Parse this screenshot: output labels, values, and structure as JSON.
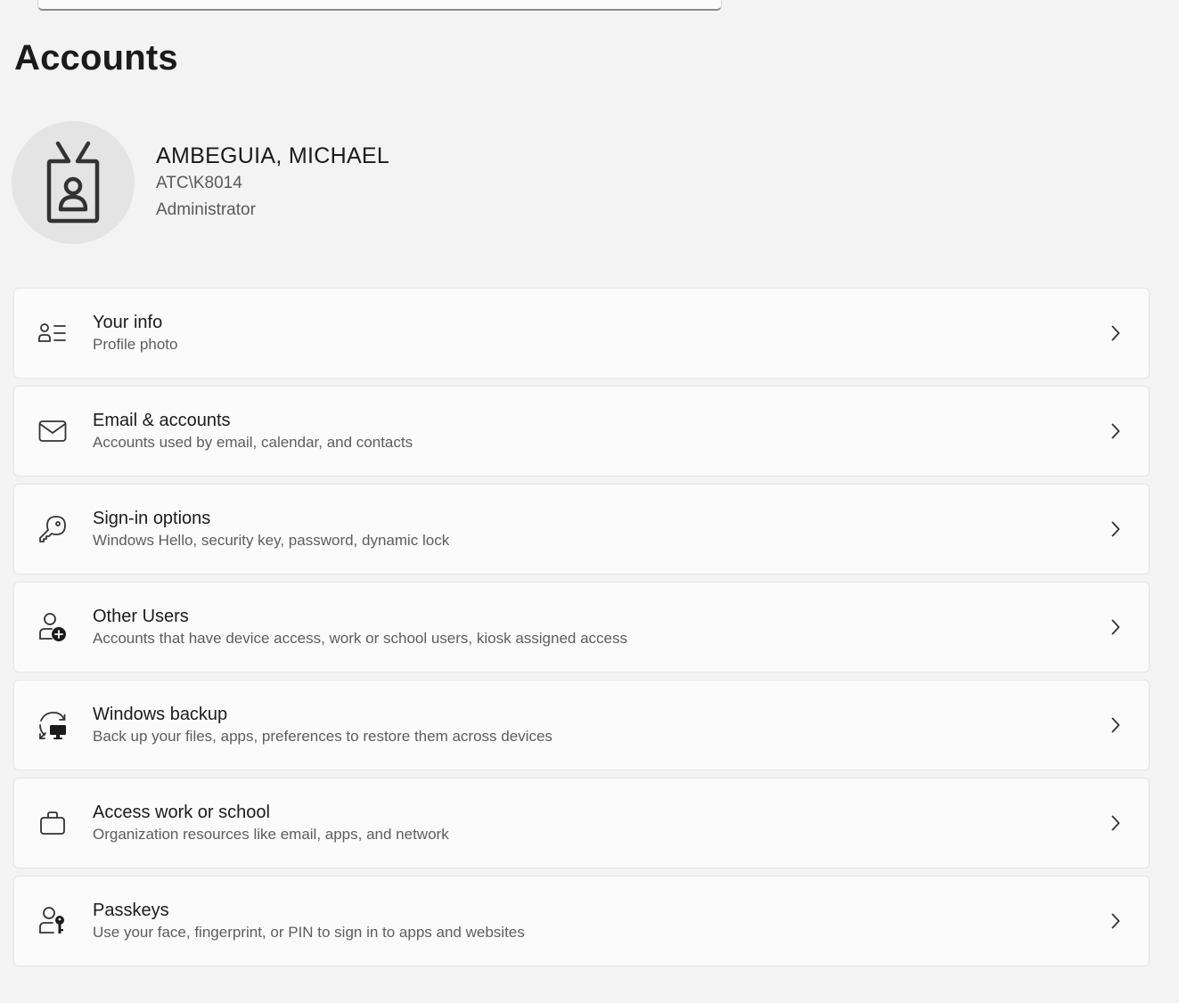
{
  "page": {
    "title": "Accounts"
  },
  "profile": {
    "name": "AMBEGUIA, MICHAEL",
    "account": "ATC\\K8014",
    "role": "Administrator"
  },
  "cards": [
    {
      "icon": "user-info-icon",
      "title": "Your info",
      "description": "Profile photo"
    },
    {
      "icon": "mail-icon",
      "title": "Email & accounts",
      "description": "Accounts used by email, calendar, and contacts"
    },
    {
      "icon": "key-icon",
      "title": "Sign-in options",
      "description": "Windows Hello, security key, password, dynamic lock"
    },
    {
      "icon": "add-user-icon",
      "title": "Other Users",
      "description": "Accounts that have device access, work or school users, kiosk assigned access"
    },
    {
      "icon": "backup-icon",
      "title": "Windows backup",
      "description": "Back up your files, apps, preferences to restore them across devices"
    },
    {
      "icon": "briefcase-icon",
      "title": "Access work or school",
      "description": "Organization resources like email, apps, and network"
    },
    {
      "icon": "passkey-icon",
      "title": "Passkeys",
      "description": "Use your face, fingerprint, or PIN to sign in to apps and websites"
    }
  ],
  "colors": {
    "background": "#f3f3f3",
    "card": "#fbfbfb",
    "text_primary": "#1b1b1b",
    "text_secondary": "#5d5d5d"
  }
}
